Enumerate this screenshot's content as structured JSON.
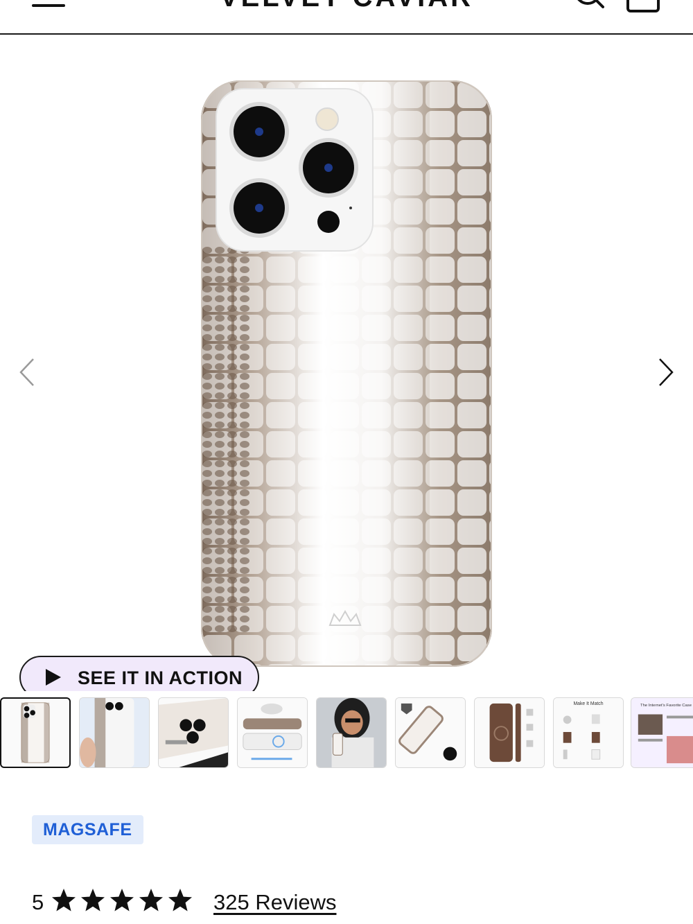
{
  "header": {
    "brand": "VELVET CAVIAR",
    "menu_icon": "hamburger-menu-icon",
    "search_icon": "search-icon",
    "cart_icon": "shopping-bag-icon"
  },
  "gallery": {
    "prev_icon": "chevron-left-icon",
    "next_icon": "chevron-right-icon",
    "product_image": "white-croc-phone-case",
    "action_button": {
      "label": "SEE IT IN ACTION",
      "icon": "play-icon",
      "background": "#f1e9fb"
    }
  },
  "thumbnails": [
    {
      "name": "case-front",
      "active": true
    },
    {
      "name": "case-held-in-hand",
      "active": false
    },
    {
      "name": "camera-protection-closeup",
      "active": false
    },
    {
      "name": "magsafe-compatible",
      "active": false
    },
    {
      "name": "model-with-case",
      "active": false
    },
    {
      "name": "drop-tested-case",
      "active": false
    },
    {
      "name": "case-side-views",
      "active": false
    },
    {
      "name": "make-it-match-accessories",
      "active": false
    },
    {
      "name": "internets-favorite-case",
      "active": false
    }
  ],
  "thumbnail_text": {
    "make_it_match": "Make It Match",
    "favorite_case": "The Internet's Favorite Case"
  },
  "product": {
    "tag": "MAGSAFE",
    "tag_color": "#1f5fd6",
    "rating_value": "5",
    "stars": 5,
    "reviews_label": "325 Reviews"
  }
}
